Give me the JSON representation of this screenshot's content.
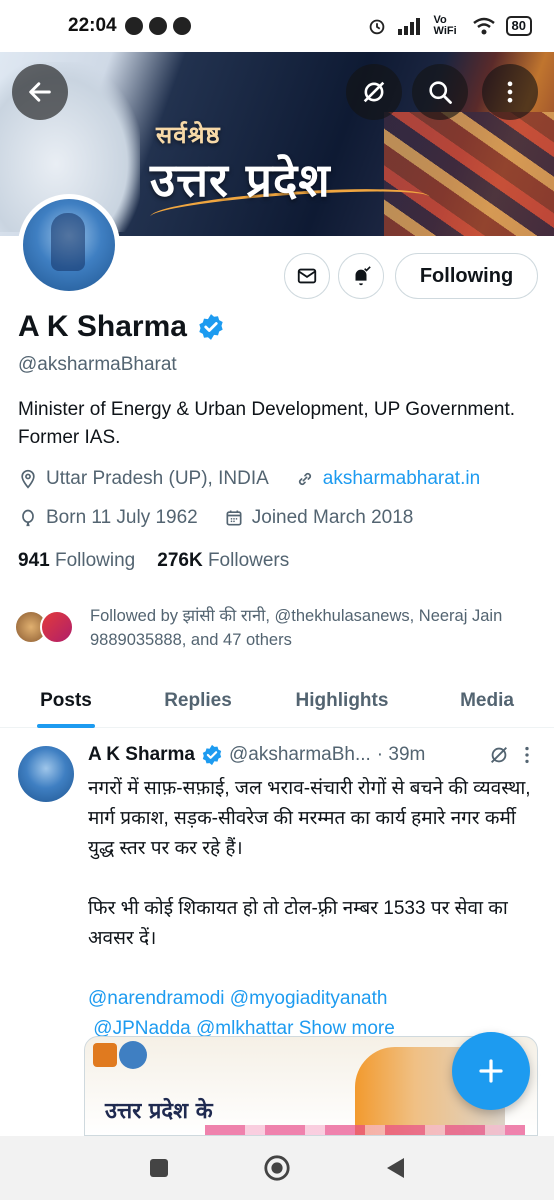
{
  "status_bar": {
    "time": "22:04",
    "network_label": "Vo WiFi",
    "battery": "80"
  },
  "banner": {
    "title_small": "सर्वश्रेष्ठ",
    "title_main": "उत्तर प्रदेश"
  },
  "profile": {
    "name": "A K Sharma",
    "handle": "@aksharmaBharat",
    "bio": "Minister of Energy & Urban Development, UP Government. Former IAS.",
    "location": "Uttar Pradesh (UP), INDIA",
    "website": "aksharmabharat.in",
    "born": "Born 11 July 1962",
    "joined": "Joined March 2018",
    "following_count": "941",
    "following_label": "Following",
    "followers_count": "276K",
    "followers_label": "Followers",
    "follow_button": "Following",
    "followed_by": "Followed by झांसी की रानी, @thekhulasanews, Neeraj Jain 9889035888, and 47 others"
  },
  "tabs": [
    {
      "label": "Posts",
      "active": true
    },
    {
      "label": "Replies",
      "active": false
    },
    {
      "label": "Highlights",
      "active": false
    },
    {
      "label": "Media",
      "active": false
    }
  ],
  "tweet": {
    "author": "A K Sharma",
    "handle": "@aksharmaBh...",
    "time": "· 39m",
    "paragraph1": "नगरों में साफ़-सफ़ाई, जल भराव-संचारी रोगों से बचने की व्यवस्था, मार्ग प्रकाश, सड़क-सीवरेज की मरम्मत का कार्य हमारे नगर कर्मी युद्ध स्तर पर कर रहे हैं।",
    "paragraph2": "फिर भी कोई शिकायत हो तो टोल-फ़्री नम्बर 1533 पर सेवा का अवसर दें।",
    "mentions_line1": "@narendramodi @myogiadityanath",
    "mentions_line2": "@JPNadda @mlkhattar",
    "show_more": "Show more",
    "media_title": "उत्तर प्रदेश के"
  },
  "colors": {
    "accent": "#1d9bf0",
    "text_primary": "#0f1419",
    "text_secondary": "#536471"
  }
}
